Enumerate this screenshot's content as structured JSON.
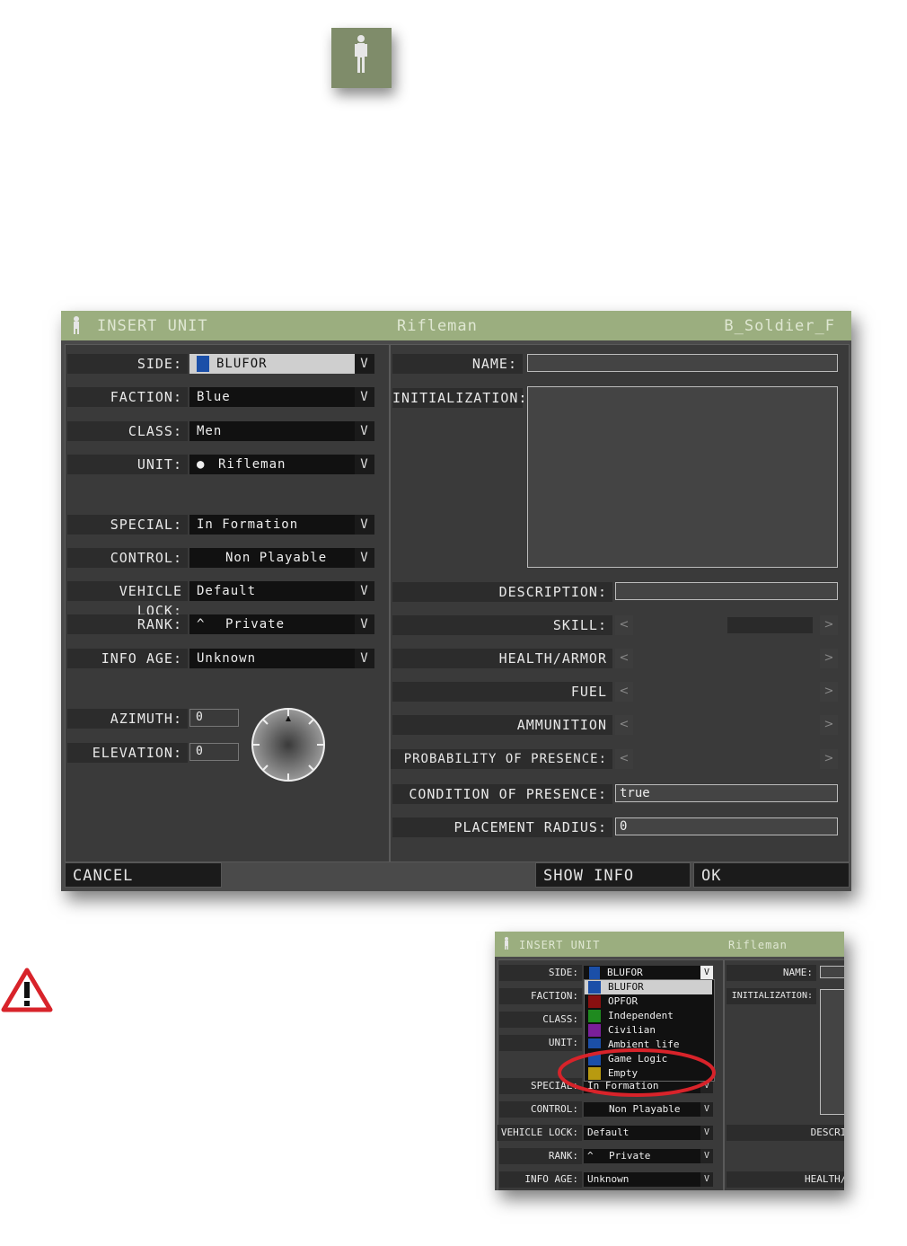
{
  "unit_tile": {
    "icon": "soldier-icon",
    "color": "#7f8c6a"
  },
  "dialog": {
    "title": "INSERT UNIT",
    "unit_name": "Rifleman",
    "class_name": "B_Soldier_F",
    "left": {
      "side": {
        "label": "SIDE:",
        "value": "BLUFOR",
        "color": "#1b4fa8"
      },
      "faction": {
        "label": "FACTION:",
        "value": "Blue"
      },
      "class": {
        "label": "CLASS:",
        "value": "Men"
      },
      "unit": {
        "label": "UNIT:",
        "value": "Rifleman"
      },
      "special": {
        "label": "SPECIAL:",
        "value": "In Formation"
      },
      "control": {
        "label": "CONTROL:",
        "value": "Non Playable"
      },
      "vehicle_lock": {
        "label": "VEHICLE LOCK:",
        "value": "Default"
      },
      "rank": {
        "label": "RANK:",
        "value": "Private"
      },
      "info_age": {
        "label": "INFO AGE:",
        "value": "Unknown"
      },
      "azimuth": {
        "label": "AZIMUTH:",
        "value": "0"
      },
      "elevation": {
        "label": "ELEVATION:",
        "value": "0"
      },
      "arrow": "V"
    },
    "right": {
      "name": {
        "label": "NAME:",
        "value": ""
      },
      "initialization": {
        "label": "INITIALIZATION:",
        "value": ""
      },
      "description": {
        "label": "DESCRIPTION:",
        "value": ""
      },
      "skill": {
        "label": "SKILL:"
      },
      "health": {
        "label": "HEALTH/ARMOR"
      },
      "fuel": {
        "label": "FUEL"
      },
      "ammunition": {
        "label": "AMMUNITION"
      },
      "probability": {
        "label": "PROBABILITY OF PRESENCE:"
      },
      "condition": {
        "label": "CONDITION OF PRESENCE:",
        "value": "true"
      },
      "placement": {
        "label": "PLACEMENT RADIUS:",
        "value": "0"
      },
      "left_arrow": "<",
      "right_arrow": ">"
    },
    "buttons": {
      "cancel": "CANCEL",
      "show_info": "SHOW INFO",
      "ok": "OK"
    }
  },
  "shot2": {
    "title": "INSERT UNIT",
    "unit_name": "Rifleman",
    "labels": {
      "side": "SIDE:",
      "faction": "FACTION:",
      "class": "CLASS:",
      "unit": "UNIT:",
      "special": "SPECIAL:",
      "control": "CONTROL:",
      "vehicle_lock": "VEHICLE LOCK:",
      "rank": "RANK:",
      "info_age": "INFO AGE:",
      "name": "NAME:",
      "initialization": "INITIALIZATION:",
      "descr": "DESCRIP",
      "health": "HEALTH/A"
    },
    "values": {
      "side": "BLUFOR",
      "special": "In Formation",
      "control": "Non Playable",
      "vehicle_lock": "Default",
      "rank": "Private",
      "info_age": "Unknown"
    },
    "dropdown": [
      {
        "label": "BLUFOR",
        "color": "#1b4fa8"
      },
      {
        "label": "OPFOR",
        "color": "#8a1010"
      },
      {
        "label": "Independent",
        "color": "#1f8a1f"
      },
      {
        "label": "Civilian",
        "color": "#7a1f9a"
      },
      {
        "label": "Ambient life",
        "color": "#1b4fa8"
      },
      {
        "label": "Game Logic",
        "color": "#1b4fa8"
      },
      {
        "label": "Empty",
        "color": "#b89a10"
      }
    ],
    "arrow": "V"
  },
  "warning": {
    "icon": "warning-icon",
    "color": "#d8232a"
  }
}
